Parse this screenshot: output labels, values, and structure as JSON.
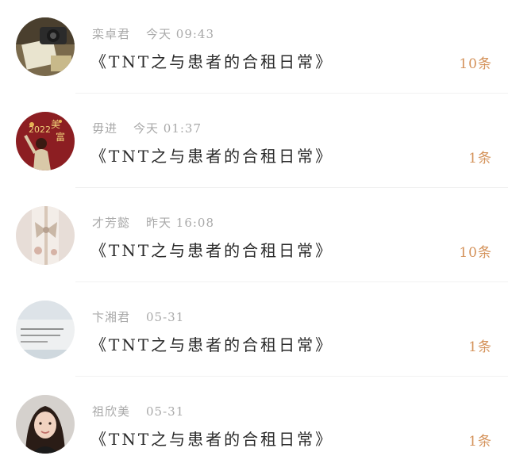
{
  "items": [
    {
      "avatar": "camera-photo-avatar",
      "name": "栾卓君",
      "time": "今天 09:43",
      "title": "《TNT之与患者的合租日常》",
      "count": "10条"
    },
    {
      "avatar": "new-year-2022-avatar",
      "name": "毋进",
      "time": "今天 01:37",
      "title": "《TNT之与患者的合租日常》",
      "count": "1条"
    },
    {
      "avatar": "phone-bow-avatar",
      "name": "才芳懿",
      "time": "昨天 16:08",
      "title": "《TNT之与患者的合租日常》",
      "count": "10条"
    },
    {
      "avatar": "handwritten-note-avatar",
      "name": "卞湘君",
      "time": "05-31",
      "title": "《TNT之与患者的合租日常》",
      "count": "1条"
    },
    {
      "avatar": "portrait-woman-avatar",
      "name": "祖欣美",
      "time": "05-31",
      "title": "《TNT之与患者的合租日常》",
      "count": "1条"
    }
  ]
}
